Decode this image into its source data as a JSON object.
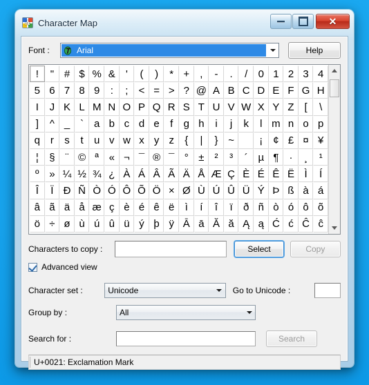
{
  "window": {
    "title": "Character Map",
    "icon": "character-map-icon",
    "caption_buttons": {
      "minimize": "minimize",
      "maximize": "maximize",
      "close": "✕"
    }
  },
  "font_row": {
    "label": "Font :",
    "selected_font": "Arial",
    "font_icon": "truetype-icon",
    "help_label": "Help"
  },
  "grid": {
    "selected_index": 0,
    "columns": 20,
    "characters": [
      "!",
      "\"",
      "#",
      "$",
      "%",
      "&",
      "'",
      "(",
      ")",
      "*",
      "+",
      ",",
      "-",
      ".",
      "/",
      "0",
      "1",
      "2",
      "3",
      "4",
      "5",
      "6",
      "7",
      "8",
      "9",
      ":",
      ";",
      "<",
      "=",
      ">",
      "?",
      "@",
      "A",
      "B",
      "C",
      "D",
      "E",
      "F",
      "G",
      "H",
      "I",
      "J",
      "K",
      "L",
      "M",
      "N",
      "O",
      "P",
      "Q",
      "R",
      "S",
      "T",
      "U",
      "V",
      "W",
      "X",
      "Y",
      "Z",
      "[",
      "\\",
      "]",
      "^",
      "_",
      "`",
      "a",
      "b",
      "c",
      "d",
      "e",
      "f",
      "g",
      "h",
      "i",
      "j",
      "k",
      "l",
      "m",
      "n",
      "o",
      "p",
      "q",
      "r",
      "s",
      "t",
      "u",
      "v",
      "w",
      "x",
      "y",
      "z",
      "{",
      "|",
      "}",
      "~",
      " ",
      "¡",
      "¢",
      "£",
      "¤",
      "¥",
      "¦",
      "§",
      "¨",
      "©",
      "ª",
      "«",
      "¬",
      "¯",
      "®",
      "¯",
      "°",
      "±",
      "²",
      "³",
      "´",
      "µ",
      "¶",
      "·",
      "¸",
      "¹",
      "º",
      "»",
      "¼",
      "½",
      "¾",
      "¿",
      "À",
      "Á",
      "Â",
      "Ã",
      "Ä",
      "Å",
      "Æ",
      "Ç",
      "È",
      "É",
      "Ê",
      "Ë",
      "Ì",
      "Í",
      "Î",
      "Ï",
      "Ð",
      "Ñ",
      "Ò",
      "Ó",
      "Ô",
      "Õ",
      "Ö",
      "×",
      "Ø",
      "Ù",
      "Ú",
      "Û",
      "Ü",
      "Ý",
      "Þ",
      "ß",
      "à",
      "á",
      "â",
      "ã",
      "ä",
      "å",
      "æ",
      "ç",
      "è",
      "é",
      "ê",
      "ë",
      "ì",
      "í",
      "î",
      "ï",
      "ð",
      "ñ",
      "ò",
      "ó",
      "ô",
      "õ",
      "ö",
      "÷",
      "ø",
      "ù",
      "ú",
      "û",
      "ü",
      "ý",
      "þ",
      "ÿ",
      "Ā",
      "ā",
      "Ă",
      "ă",
      "Ą",
      "ą",
      "Ć",
      "ć",
      "Ĉ",
      "ĉ"
    ]
  },
  "scrollbar": {
    "up_arrow": "scroll-up",
    "down_arrow": "scroll-down",
    "thumb_position_percent": 2
  },
  "copy_row": {
    "label": "Characters to copy :",
    "value": "",
    "select_label": "Select",
    "copy_label": "Copy",
    "copy_disabled": true
  },
  "advanced_view": {
    "label": "Advanced view",
    "checked": true
  },
  "character_set": {
    "label": "Character set :",
    "value": "Unicode"
  },
  "go_to_unicode": {
    "label": "Go to Unicode :",
    "value": ""
  },
  "group_by": {
    "label": "Group by :",
    "value": "All"
  },
  "search": {
    "label": "Search for :",
    "value": "",
    "button_label": "Search",
    "button_disabled": true
  },
  "statusbar": {
    "text": "U+0021: Exclamation Mark"
  },
  "colors": {
    "accent_blue": "#2e8ae6",
    "desktop": "#18a4ee",
    "close_red": "#d9452f",
    "focus_border": "#3c8ad0"
  }
}
